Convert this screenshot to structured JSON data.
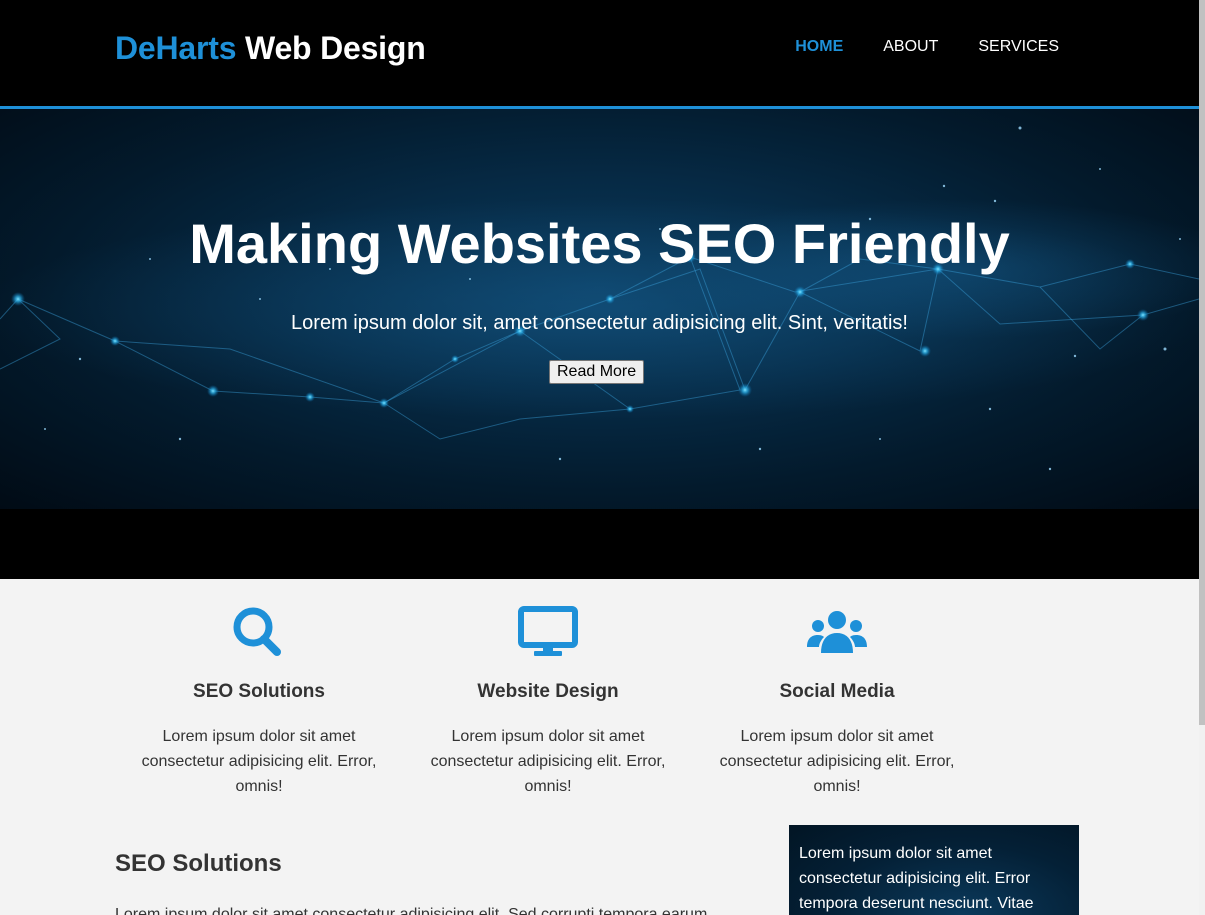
{
  "header": {
    "logo_brand": "DeHarts",
    "logo_rest": " Web Design",
    "nav": [
      {
        "label": "HOME",
        "active": true
      },
      {
        "label": "ABOUT",
        "active": false
      },
      {
        "label": "SERVICES",
        "active": false
      }
    ]
  },
  "hero": {
    "title": "Making Websites SEO Friendly",
    "subtitle": "Lorem ipsum dolor sit, amet consectetur adipisicing elit. Sint, veritatis!",
    "button_label": "Read More"
  },
  "features": [
    {
      "icon": "search-icon",
      "title": "SEO Solutions",
      "text": "Lorem ipsum dolor sit amet consectetur adipisicing elit. Error, omnis!"
    },
    {
      "icon": "monitor-icon",
      "title": "Website Design",
      "text": "Lorem ipsum dolor sit amet consectetur adipisicing elit. Error, omnis!"
    },
    {
      "icon": "users-icon",
      "title": "Social Media",
      "text": "Lorem ipsum dolor sit amet consectetur adipisicing elit. Error, omnis!"
    }
  ],
  "main": {
    "heading": "SEO Solutions",
    "text": "Lorem ipsum dolor sit amet consectetur adipisicing elit. Sed corrupti tempora earum"
  },
  "sidebar": {
    "text": "Lorem ipsum dolor sit amet consectetur adipisicing elit. Error tempora deserunt nesciunt. Vitae"
  },
  "colors": {
    "accent": "#1e90d8",
    "header_bg": "#000000",
    "body_bg": "#f3f3f3",
    "text": "#333333"
  }
}
